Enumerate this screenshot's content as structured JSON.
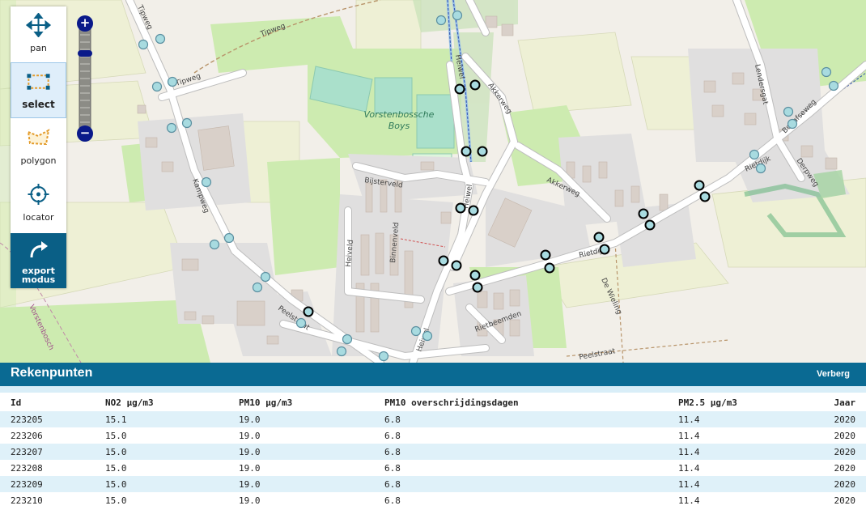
{
  "map": {
    "street_labels": [
      "Tipweg",
      "Tipweg",
      "Tipweg",
      "Kampweg",
      "Heiwel",
      "Akkerweg",
      "Akkerweg",
      "Lendersgat",
      "Bedafseweg",
      "Derpweg",
      "Rietdijk",
      "Rietdijk",
      "Bijsterveld",
      "Heiveld",
      "Binnenveld",
      "Heiwel",
      "Heiwel",
      "Rietbeemden",
      "Peelstraat",
      "Peelstraat",
      "De Wieling",
      "Vorstenbosch"
    ],
    "poi_label_line1": "Vorstenbossche",
    "poi_label_line2": "Boys"
  },
  "toolbar": {
    "pan_label": "pan",
    "select_label": "select",
    "polygon_label": "polygon",
    "locator_label": "locator",
    "export_label_line1": "export",
    "export_label_line2": "modus"
  },
  "zoom": {
    "plus": "+",
    "minus": "−"
  },
  "panel": {
    "title": "Rekenpunten",
    "hide_label": "Verberg",
    "columns": [
      "Id",
      "NO2 µg/m3",
      "PM10 µg/m3",
      "PM10 overschrijdingsdagen",
      "PM2.5 µg/m3",
      "Jaar"
    ],
    "rows": [
      [
        "223205",
        "15.1",
        "19.0",
        "6.8",
        "11.4",
        "2020"
      ],
      [
        "223206",
        "15.0",
        "19.0",
        "6.8",
        "11.4",
        "2020"
      ],
      [
        "223207",
        "15.0",
        "19.0",
        "6.8",
        "11.4",
        "2020"
      ],
      [
        "223208",
        "15.0",
        "19.0",
        "6.8",
        "11.4",
        "2020"
      ],
      [
        "223209",
        "15.0",
        "19.0",
        "6.8",
        "11.4",
        "2020"
      ],
      [
        "223210",
        "15.0",
        "19.0",
        "6.8",
        "11.4",
        "2020"
      ]
    ]
  },
  "colors": {
    "header": "#0a6a93",
    "export_button": "#0a5f86",
    "row_stripe": "#dff1f9",
    "marker_selected": "#a8dbe0",
    "marker_unselected": "#a8dbe0"
  }
}
